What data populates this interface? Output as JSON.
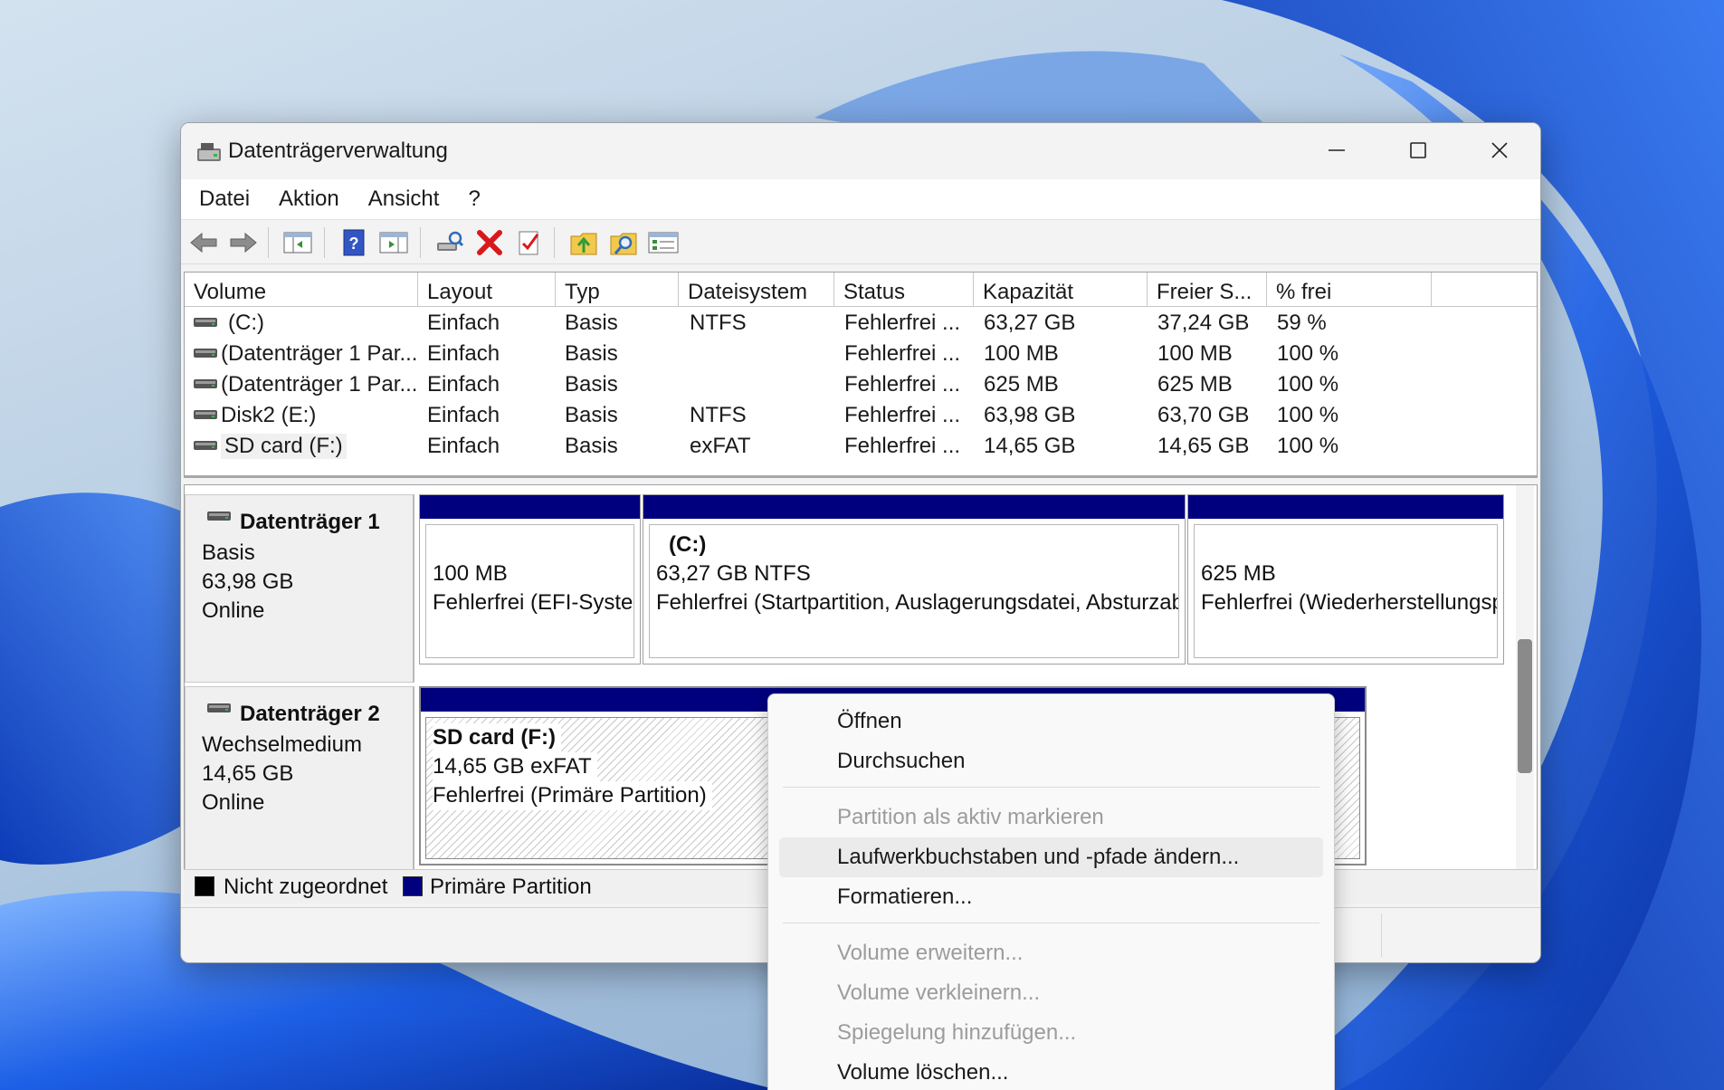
{
  "window": {
    "title": "Datenträgerverwaltung",
    "controls": {
      "minimize": "minimize",
      "maximize": "maximize",
      "close": "close"
    }
  },
  "menubar": {
    "items": [
      "Datei",
      "Aktion",
      "Ansicht",
      "?"
    ]
  },
  "toolbar": {
    "icons": [
      "back-arrow-icon",
      "forward-arrow-icon",
      "console-tree-icon",
      "help-icon",
      "action-pane-icon",
      "connect-drive-icon",
      "delete-icon",
      "properties-check-icon",
      "up-folder-icon",
      "search-folder-icon",
      "list-view-icon"
    ]
  },
  "volume_list": {
    "columns": [
      "Volume",
      "Layout",
      "Typ",
      "Dateisystem",
      "Status",
      "Kapazität",
      "Freier S...",
      "% frei"
    ],
    "rows": [
      {
        "volume": "(C:)",
        "layout": "Einfach",
        "typ": "Basis",
        "dateisystem": "NTFS",
        "status": "Fehlerfrei ...",
        "kapazitaet": "63,27 GB",
        "frei": "37,24 GB",
        "prozent": "59 %"
      },
      {
        "volume": "(Datenträger 1 Par...",
        "layout": "Einfach",
        "typ": "Basis",
        "dateisystem": "",
        "status": "Fehlerfrei ...",
        "kapazitaet": "100 MB",
        "frei": "100 MB",
        "prozent": "100 %"
      },
      {
        "volume": "(Datenträger 1 Par...",
        "layout": "Einfach",
        "typ": "Basis",
        "dateisystem": "",
        "status": "Fehlerfrei ...",
        "kapazitaet": "625 MB",
        "frei": "625 MB",
        "prozent": "100 %"
      },
      {
        "volume": "Disk2 (E:)",
        "layout": "Einfach",
        "typ": "Basis",
        "dateisystem": "NTFS",
        "status": "Fehlerfrei ...",
        "kapazitaet": "63,98 GB",
        "frei": "63,70 GB",
        "prozent": "100 %"
      },
      {
        "volume": "SD card (F:)",
        "layout": "Einfach",
        "typ": "Basis",
        "dateisystem": "exFAT",
        "status": "Fehlerfrei ...",
        "kapazitaet": "14,65 GB",
        "frei": "14,65 GB",
        "prozent": "100 %"
      }
    ]
  },
  "disks": [
    {
      "name": "Datenträger 1",
      "type": "Basis",
      "size": "63,98 GB",
      "state": "Online",
      "partitions": [
        {
          "name": "",
          "line1": "100 MB",
          "line2": "Fehlerfrei (EFI-Systempartition)"
        },
        {
          "name": "(C:)",
          "line1": "63,27 GB NTFS",
          "line2": "Fehlerfrei (Startpartition, Auslagerungsdatei, Absturzabbild, Primäre Partition)"
        },
        {
          "name": "",
          "line1": "625 MB",
          "line2": "Fehlerfrei (Wiederherstellungspartition)"
        }
      ]
    },
    {
      "name": "Datenträger 2",
      "type": "Wechselmedium",
      "size": "14,65 GB",
      "state": "Online",
      "partitions": [
        {
          "name": "SD card  (F:)",
          "line1": "14,65 GB exFAT",
          "line2": "Fehlerfrei (Primäre Partition)"
        }
      ]
    }
  ],
  "legend": [
    {
      "label": "Nicht zugeordnet",
      "color": "#000000"
    },
    {
      "label": "Primäre Partition",
      "color": "#00007f"
    }
  ],
  "context_menu": {
    "items": [
      {
        "label": "Öffnen",
        "enabled": true
      },
      {
        "label": "Durchsuchen",
        "enabled": true
      },
      {
        "label": "Partition als aktiv markieren",
        "enabled": false
      },
      {
        "label": "Laufwerkbuchstaben und -pfade ändern...",
        "enabled": true,
        "highlighted": true
      },
      {
        "label": "Formatieren...",
        "enabled": true
      },
      {
        "label": "Volume erweitern...",
        "enabled": false
      },
      {
        "label": "Volume verkleinern...",
        "enabled": false
      },
      {
        "label": "Spiegelung hinzufügen...",
        "enabled": false
      },
      {
        "label": "Volume löschen...",
        "enabled": true
      }
    ]
  },
  "colors": {
    "primary_partition": "#00007f",
    "wallpaper_accent": "#1f5fe0"
  }
}
